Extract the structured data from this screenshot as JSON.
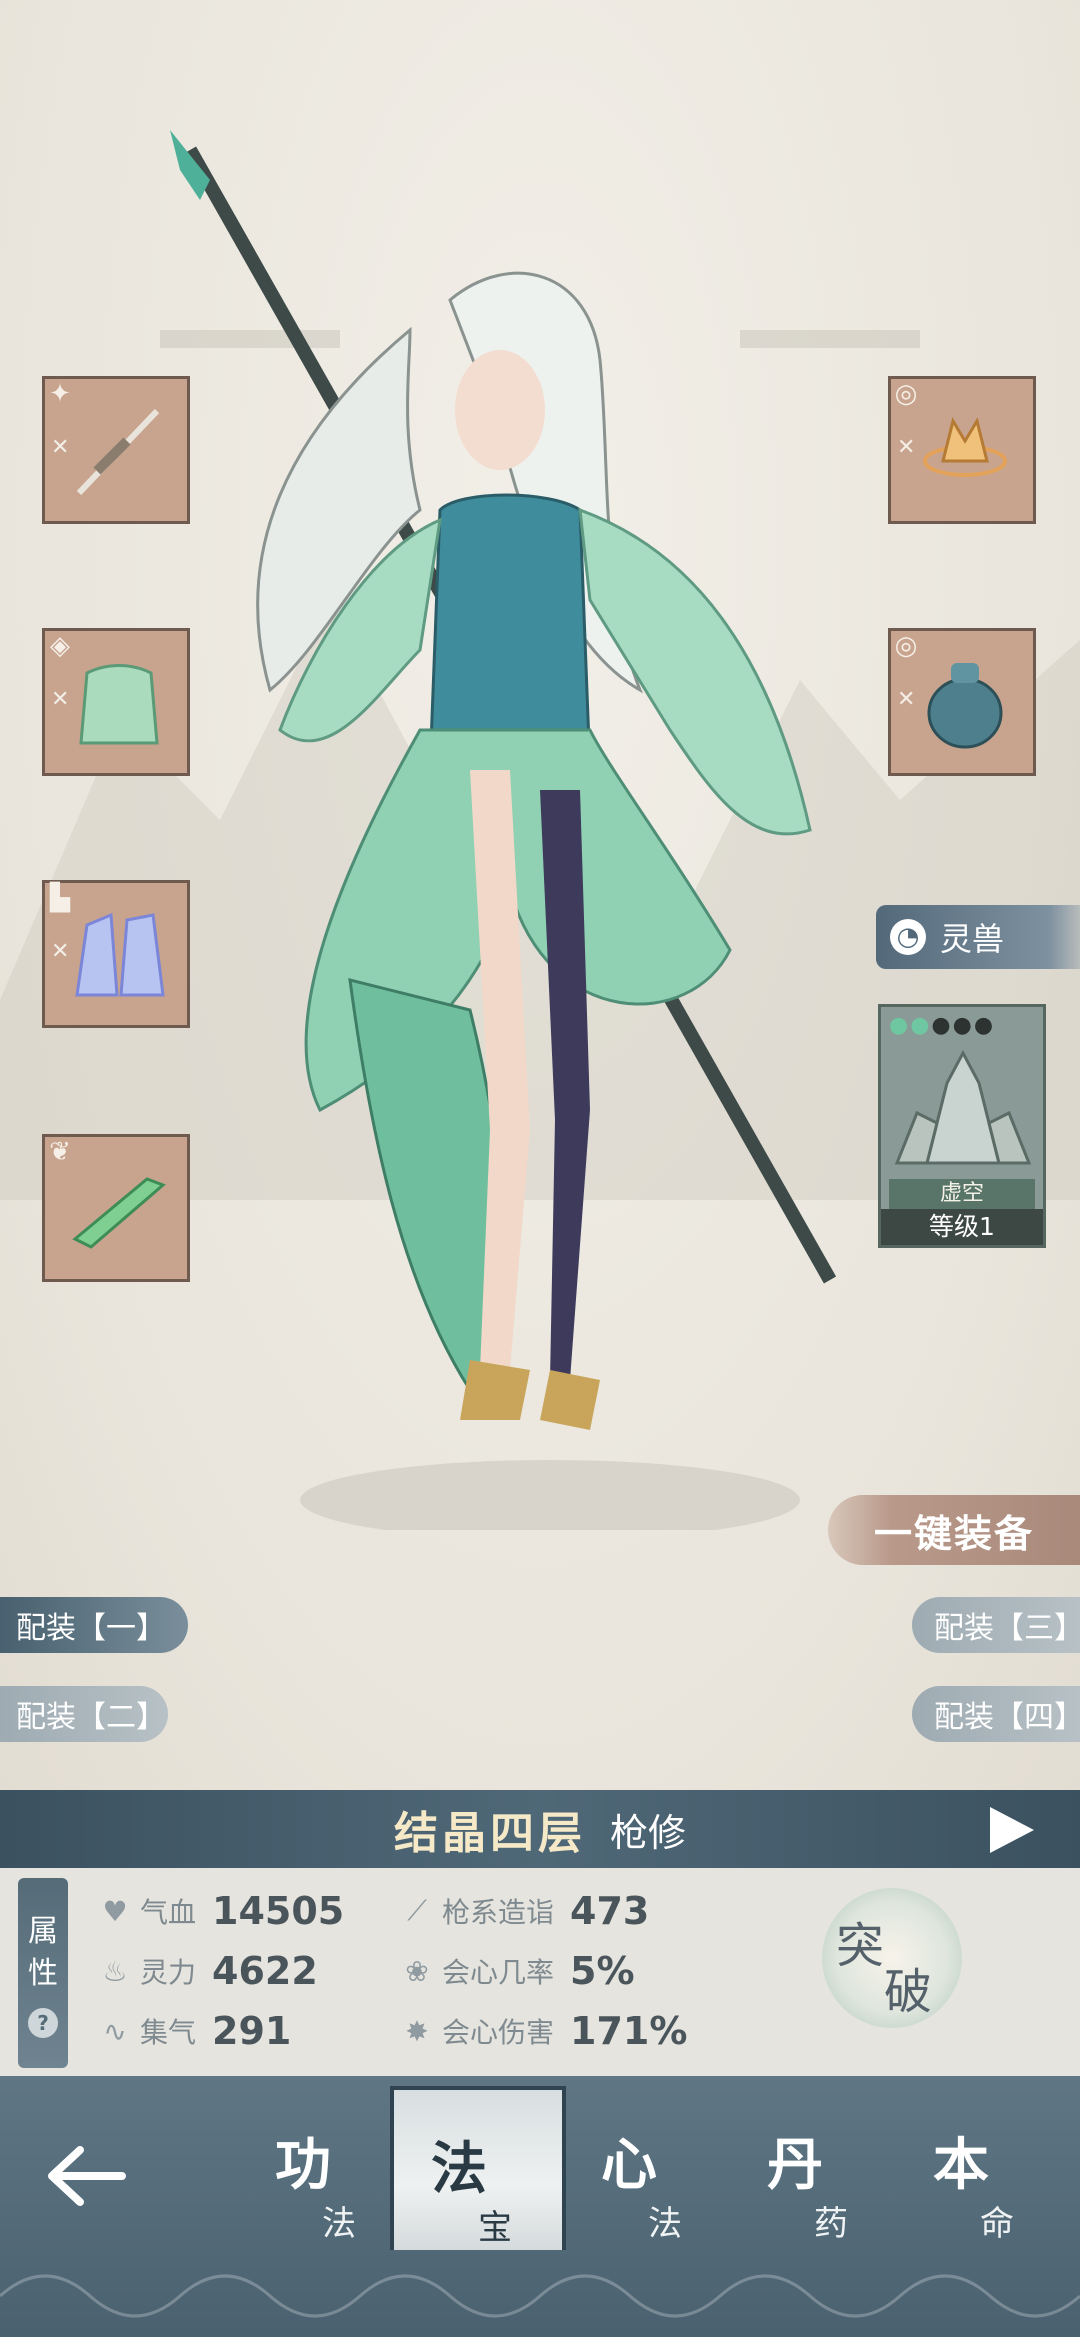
{
  "equipment_slots_left": [
    {
      "slot_icon": "spear-slot-icon",
      "item": "spear"
    },
    {
      "slot_icon": "armor-slot-icon",
      "item": "robe"
    },
    {
      "slot_icon": "boots-slot-icon",
      "item": "boots"
    },
    {
      "slot_icon": "wing-slot-icon",
      "item": "jade-blade"
    }
  ],
  "equipment_slots_right": [
    {
      "slot_icon": "ring-slot-icon",
      "item": "golden-crown"
    },
    {
      "slot_icon": "ring-slot-icon",
      "item": "jade-pendant"
    }
  ],
  "spirit_beast": {
    "header_label": "灵兽",
    "name": "虚空",
    "level_label": "等级1",
    "stars_lit": 2,
    "stars_total": 5
  },
  "one_click_equip": "一键装备",
  "loadouts": [
    {
      "label": "配装【一】",
      "active": true
    },
    {
      "label": "配装【二】",
      "active": false
    },
    {
      "label": "配装【三】",
      "active": false
    },
    {
      "label": "配装【四】",
      "active": false
    }
  ],
  "realm": {
    "stage": "结晶四层",
    "class": "枪修"
  },
  "attributes": {
    "tab_top": "属",
    "tab_bottom": "性",
    "help": "?",
    "stats": [
      {
        "icon": "heart-icon",
        "label": "气血",
        "value": "14505"
      },
      {
        "icon": "flame-icon",
        "label": "灵力",
        "value": "4622"
      },
      {
        "icon": "swirl-icon",
        "label": "集气",
        "value": "291"
      },
      {
        "icon": "spear-icon",
        "label": "枪系造诣",
        "value": "473"
      },
      {
        "icon": "crit-icon",
        "label": "会心几率",
        "value": "5%"
      },
      {
        "icon": "burst-icon",
        "label": "会心伤害",
        "value": "171%"
      }
    ]
  },
  "breakthrough": {
    "c1": "突",
    "c2": "破"
  },
  "nav": {
    "tabs": [
      {
        "big": "功",
        "small": "法"
      },
      {
        "big": "法",
        "small": "宝"
      },
      {
        "big": "心",
        "small": "法"
      },
      {
        "big": "丹",
        "small": "药"
      },
      {
        "big": "本",
        "small": "命"
      }
    ],
    "active_index": 1
  },
  "colors": {
    "accent": "#4f6877",
    "slot_bg": "#c8a48f",
    "gold_text": "#f6e9c8"
  }
}
